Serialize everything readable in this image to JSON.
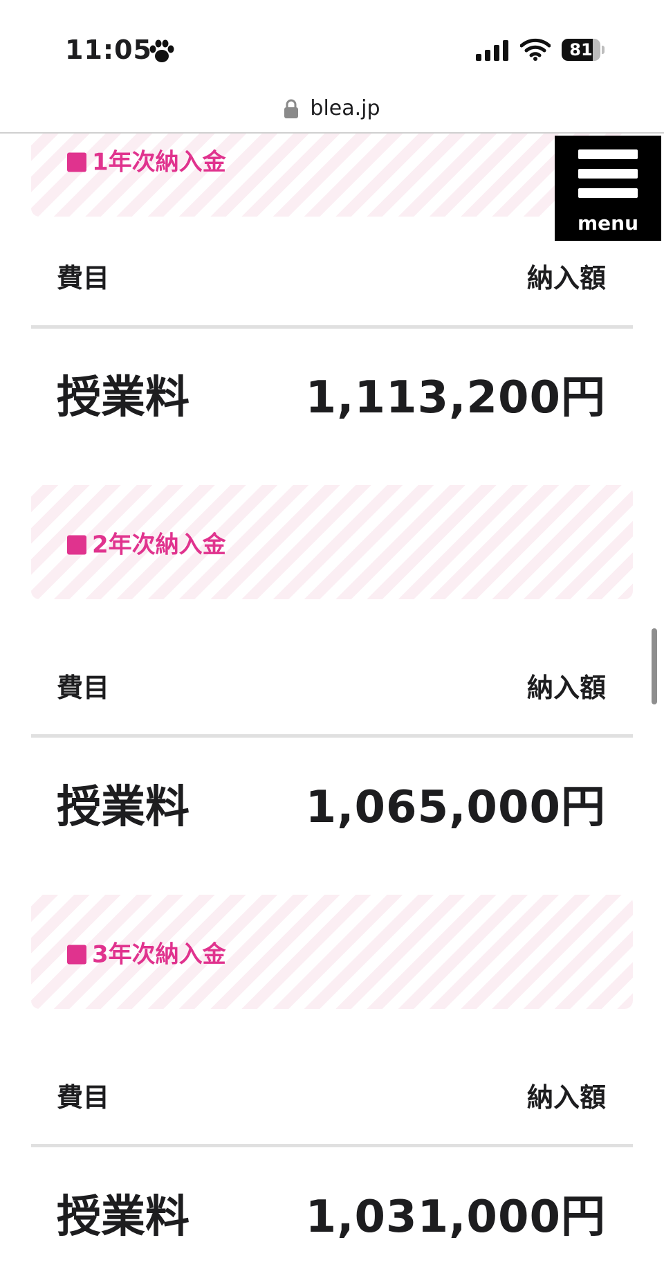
{
  "status_bar": {
    "time": "11:05",
    "battery_level": "81",
    "battery_fraction": 0.81,
    "icons": [
      "paw-icon",
      "signal-icon",
      "wifi-icon",
      "battery-icon"
    ]
  },
  "browser": {
    "url": "blea.jp",
    "lock_icon": "lock-icon"
  },
  "menu": {
    "label": "menu",
    "icon": "hamburger-icon"
  },
  "colors": {
    "accent": "#e0338e",
    "stripe": "#fbeef3",
    "text": "#1d1d1f"
  },
  "sections": [
    {
      "title": "1年次納入金",
      "header_left": "費目",
      "header_right": "納入額",
      "item": "授業料",
      "amount": "1,113,200円"
    },
    {
      "title": "2年次納入金",
      "header_left": "費目",
      "header_right": "納入額",
      "item": "授業料",
      "amount": "1,065,000円"
    },
    {
      "title": "3年次納入金",
      "header_left": "費目",
      "header_right": "納入額",
      "item": "授業料",
      "amount": "1,031,000円"
    }
  ]
}
